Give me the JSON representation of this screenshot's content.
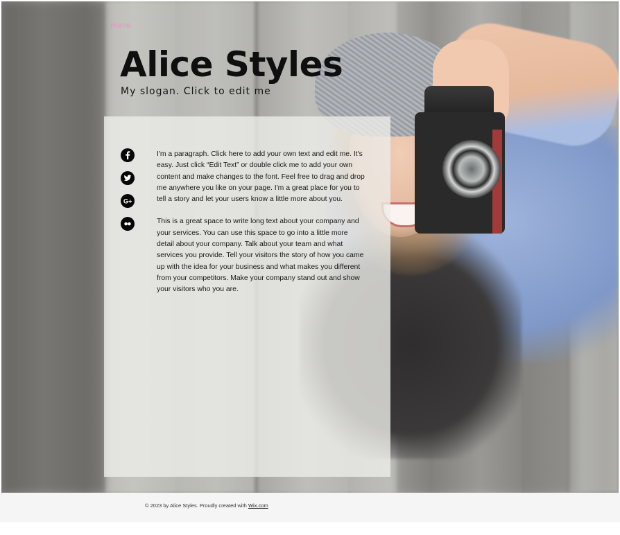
{
  "nav": {
    "home_label": "Home"
  },
  "header": {
    "title": "Alice Styles",
    "slogan": "My slogan. Click to edit me"
  },
  "social": {
    "items": [
      {
        "icon": "facebook-icon"
      },
      {
        "icon": "twitter-icon"
      },
      {
        "icon": "google-plus-icon"
      },
      {
        "icon": "flickr-icon"
      }
    ]
  },
  "content": {
    "paragraph_1": "I'm a paragraph. Click here to add your own text and edit me. It's easy. Just click “Edit Text” or double click me to add your own content and make changes to the font. Feel free to drag and drop me anywhere you like on your page. I'm a great place for you to tell a story and let your users know a little more about you.",
    "paragraph_2": "This is a great space to write long text about your company and your services. You can use this space to go into a little more detail about your company. Talk about your team and what services you provide. Tell your visitors the story of how you came up with the idea for your business and what makes you different from your competitors. Make your company stand out and show your visitors who you are."
  },
  "footer": {
    "text": "© 2023 by Alice Styles. Proudly created with",
    "link_label": "Wix.com"
  },
  "colors": {
    "nav_link": "#f68bc4",
    "title": "#0f0f0f",
    "panel": "#ecece9",
    "footer_bg": "#f5f5f5"
  }
}
